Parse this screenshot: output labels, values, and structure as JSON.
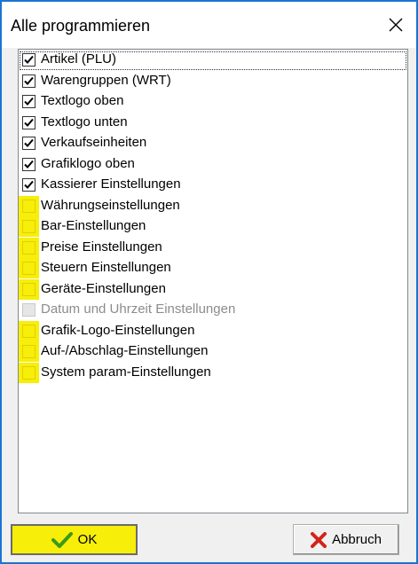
{
  "dialog": {
    "title": "Alle programmieren"
  },
  "items": [
    {
      "label": "Artikel (PLU)",
      "checked": true,
      "state": "checked"
    },
    {
      "label": "Warengruppen (WRT)",
      "checked": true,
      "state": "checked"
    },
    {
      "label": "Textlogo oben",
      "checked": true,
      "state": "checked"
    },
    {
      "label": "Textlogo unten",
      "checked": true,
      "state": "checked"
    },
    {
      "label": "Verkaufseinheiten",
      "checked": true,
      "state": "checked"
    },
    {
      "label": "Grafiklogo oben",
      "checked": true,
      "state": "checked"
    },
    {
      "label": "Kassierer Einstellungen",
      "checked": true,
      "state": "checked"
    },
    {
      "label": "Währungseinstellungen",
      "checked": false,
      "state": "highlighted"
    },
    {
      "label": "Bar-Einstellungen",
      "checked": false,
      "state": "highlighted"
    },
    {
      "label": "Preise Einstellungen",
      "checked": false,
      "state": "highlighted"
    },
    {
      "label": "Steuern Einstellungen",
      "checked": false,
      "state": "highlighted"
    },
    {
      "label": "Geräte-Einstellungen",
      "checked": false,
      "state": "highlighted"
    },
    {
      "label": "Datum und Uhrzeit Einstellungen",
      "checked": false,
      "state": "disabled"
    },
    {
      "label": "Grafik-Logo-Einstellungen",
      "checked": false,
      "state": "highlighted"
    },
    {
      "label": "Auf-/Abschlag-Einstellungen",
      "checked": false,
      "state": "highlighted"
    },
    {
      "label": "System param-Einstellungen",
      "checked": false,
      "state": "highlighted"
    }
  ],
  "buttons": {
    "ok_label": "OK",
    "cancel_label": "Abbruch"
  },
  "icons": {
    "close": "close-icon",
    "ok": "checkmark-icon",
    "cancel": "red-x-icon"
  },
  "colors": {
    "highlight": "#f7ee0a",
    "window_border": "#1a74d4",
    "ok_check": "#3a9a1a",
    "cancel_x": "#d2231a",
    "disabled_text": "#8c8c8c"
  }
}
